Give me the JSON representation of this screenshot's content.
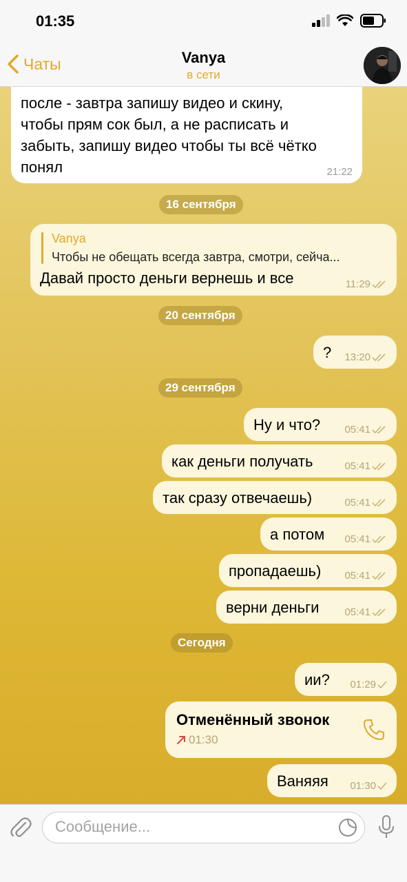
{
  "status_bar": {
    "time": "01:35"
  },
  "header": {
    "back_label": "Чаты",
    "title": "Vanya",
    "status": "в сети"
  },
  "messages": {
    "m1": {
      "lines": [
        "после - завтра запишу видео и скину,",
        "чтобы прям сок был, а не расписать и",
        "забыть, запишу видео чтобы ты всё чётко",
        "понял"
      ],
      "time": "21:22"
    },
    "d1": "16 сентября",
    "m2": {
      "reply_author": "Vanya",
      "reply_text": "Чтобы не обещать всегда завтра, смотри, сейча...",
      "text": "Давай просто деньги вернешь и все",
      "time": "11:29"
    },
    "d2": "20 сентября",
    "m3": {
      "text": "?",
      "time": "13:20"
    },
    "d3": "29 сентября",
    "m4": {
      "text": "Ну  и что?",
      "time": "05:41"
    },
    "m5": {
      "text": "как деньги получать",
      "time": "05:41"
    },
    "m6": {
      "text": "так сразу отвечаешь)",
      "time": "05:41"
    },
    "m7": {
      "text": "а потом",
      "time": "05:41"
    },
    "m8": {
      "text": "пропадаешь)",
      "time": "05:41"
    },
    "m9": {
      "text": "верни деньги",
      "time": "05:41"
    },
    "d4": "Сегодня",
    "m10": {
      "text": "ии?",
      "time": "01:29"
    },
    "m11": {
      "title": "Отменённый звонок",
      "time": "01:30"
    },
    "m12": {
      "text": "Ваняяя",
      "time": "01:30"
    }
  },
  "input": {
    "placeholder": "Сообщение..."
  },
  "colors": {
    "accent": "#e2a92a",
    "bubble_out": "#fbf6dc",
    "bubble_in": "#ffffff",
    "missed_call": "#e0453f"
  }
}
